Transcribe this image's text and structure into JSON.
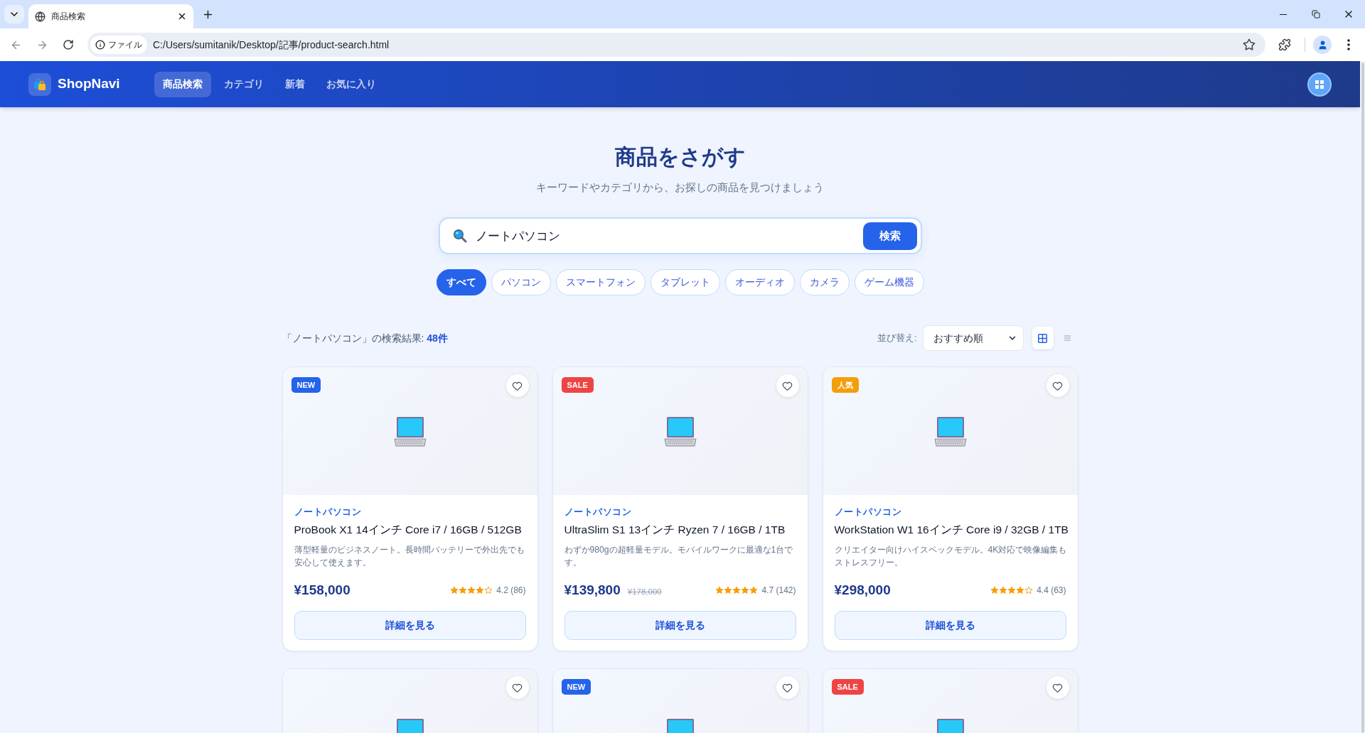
{
  "browser": {
    "tab_title": "商品検索",
    "info_chip": "ファイル",
    "url": "C:/Users/sumitanik/Desktop/記事/product-search.html"
  },
  "header": {
    "logo": "ShopNavi",
    "nav": [
      {
        "label": "商品検索",
        "selected": true
      },
      {
        "label": "カテゴリ",
        "selected": false
      },
      {
        "label": "新着",
        "selected": false
      },
      {
        "label": "お気に入り",
        "selected": false
      }
    ]
  },
  "hero": {
    "title": "商品をさがす",
    "subtitle": "キーワードやカテゴリから、お探しの商品を見つけましょう"
  },
  "search": {
    "value": "ノートパソコン",
    "button": "検索"
  },
  "categories": [
    {
      "label": "すべて",
      "selected": true
    },
    {
      "label": "パソコン",
      "selected": false
    },
    {
      "label": "スマートフォン",
      "selected": false
    },
    {
      "label": "タブレット",
      "selected": false
    },
    {
      "label": "オーディオ",
      "selected": false
    },
    {
      "label": "カメラ",
      "selected": false
    },
    {
      "label": "ゲーム機器",
      "selected": false
    }
  ],
  "results": {
    "summary": "「ノートパソコン」の検索結果: **48件**",
    "sort_label": "並び替え:",
    "sort_value": "おすすめ順",
    "views": [
      {
        "kind": "grid",
        "selected": true
      },
      {
        "kind": "list",
        "selected": false
      }
    ]
  },
  "products": [
    {
      "badge": {
        "kind": "new",
        "text": "NEW"
      },
      "favorite": false,
      "category": "ノートパソコン",
      "title": "ProBook X1 14インチ Core i7 / 16GB / 512GB",
      "description": "薄型軽量のビジネスノート。長時間バッテリーで外出先でも安心して使えます。",
      "price": "¥158,000",
      "stars": 4,
      "rating": "4.2 (86)",
      "button": "詳細を見る"
    },
    {
      "badge": {
        "kind": "sale",
        "text": "SALE"
      },
      "favorite": false,
      "category": "ノートパソコン",
      "title": "UltraSlim S1 13インチ Ryzen 7 / 16GB / 1TB",
      "description": "わずか980gの超軽量モデル。モバイルワークに最適な1台です。",
      "price": "¥139,800",
      "original_price": "¥178,000",
      "stars": 5,
      "rating": "4.7 (142)",
      "button": "詳細を見る"
    },
    {
      "badge": {
        "kind": "popular",
        "text": "人気"
      },
      "favorite": false,
      "category": "ノートパソコン",
      "title": "WorkStation W1 16インチ Core i9 / 32GB / 1TB",
      "description": "クリエイター向けハイスペックモデル。4K対応で映像編集もストレスフリー。",
      "price": "¥298,000",
      "stars": 4,
      "rating": "4.4 (63)",
      "button": "詳細を見る"
    },
    {
      "favorite": false
    },
    {
      "badge": {
        "kind": "new",
        "text": "NEW"
      },
      "favorite": false
    },
    {
      "badge": {
        "kind": "sale",
        "text": "SALE"
      },
      "favorite": false
    }
  ]
}
